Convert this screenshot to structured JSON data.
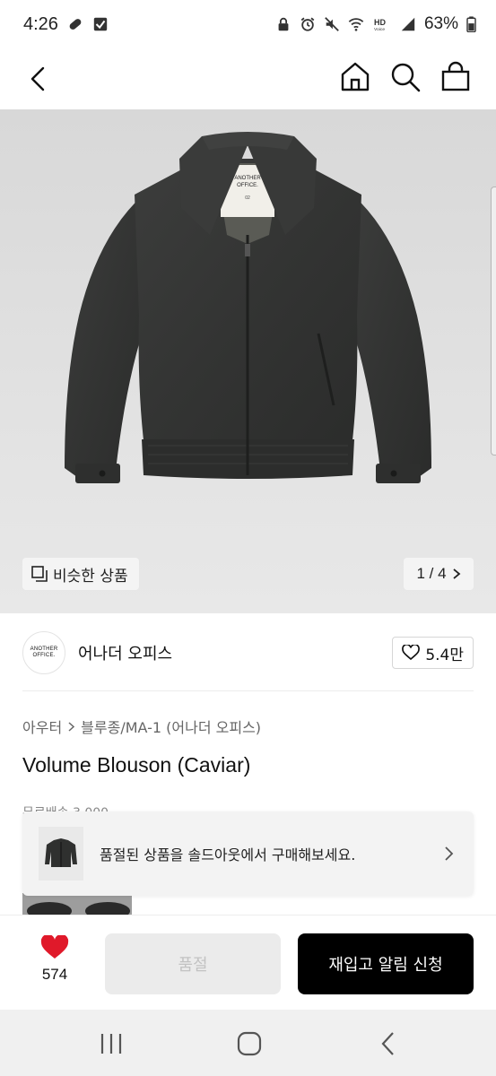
{
  "status_bar": {
    "time": "4:26",
    "battery": "63%",
    "icons_left": [
      "pill-icon",
      "checkbox-icon"
    ],
    "icons_right": [
      "lock-icon",
      "alarm-icon",
      "mute-icon",
      "wifi-icon",
      "hd-voice-icon",
      "signal-icon"
    ]
  },
  "nav": {
    "back_icon": "chevron-left-icon",
    "home_icon": "home-icon",
    "search_icon": "search-icon",
    "bag_icon": "shopping-bag-icon"
  },
  "hero": {
    "similar_label": "비슷한 상품",
    "pager": "1 / 4",
    "tag_text": "ANOTHER OFFICE.",
    "tag_size": "02"
  },
  "brand": {
    "logo_line1": "ANOTHER",
    "logo_line2": "OFFICE.",
    "name": "어나더 오피스",
    "likes": "5.4만"
  },
  "breadcrumb": {
    "category": "아우터",
    "subcategory": "블루종/MA-1 (어나더 오피스)"
  },
  "product": {
    "title": "Volume Blouson (Caviar)"
  },
  "peek": {
    "text": "무료배송 3,000"
  },
  "toast": {
    "message": "품절된 상품을 솔드아웃에서 구매해보세요."
  },
  "bottom_bar": {
    "wish_count": "574",
    "soldout_label": "품절",
    "restock_label": "재입고 알림 신청"
  },
  "colors": {
    "accent_heart": "#e0192a",
    "restock_bg": "#000000",
    "soldout_bg": "#ebebeb"
  }
}
